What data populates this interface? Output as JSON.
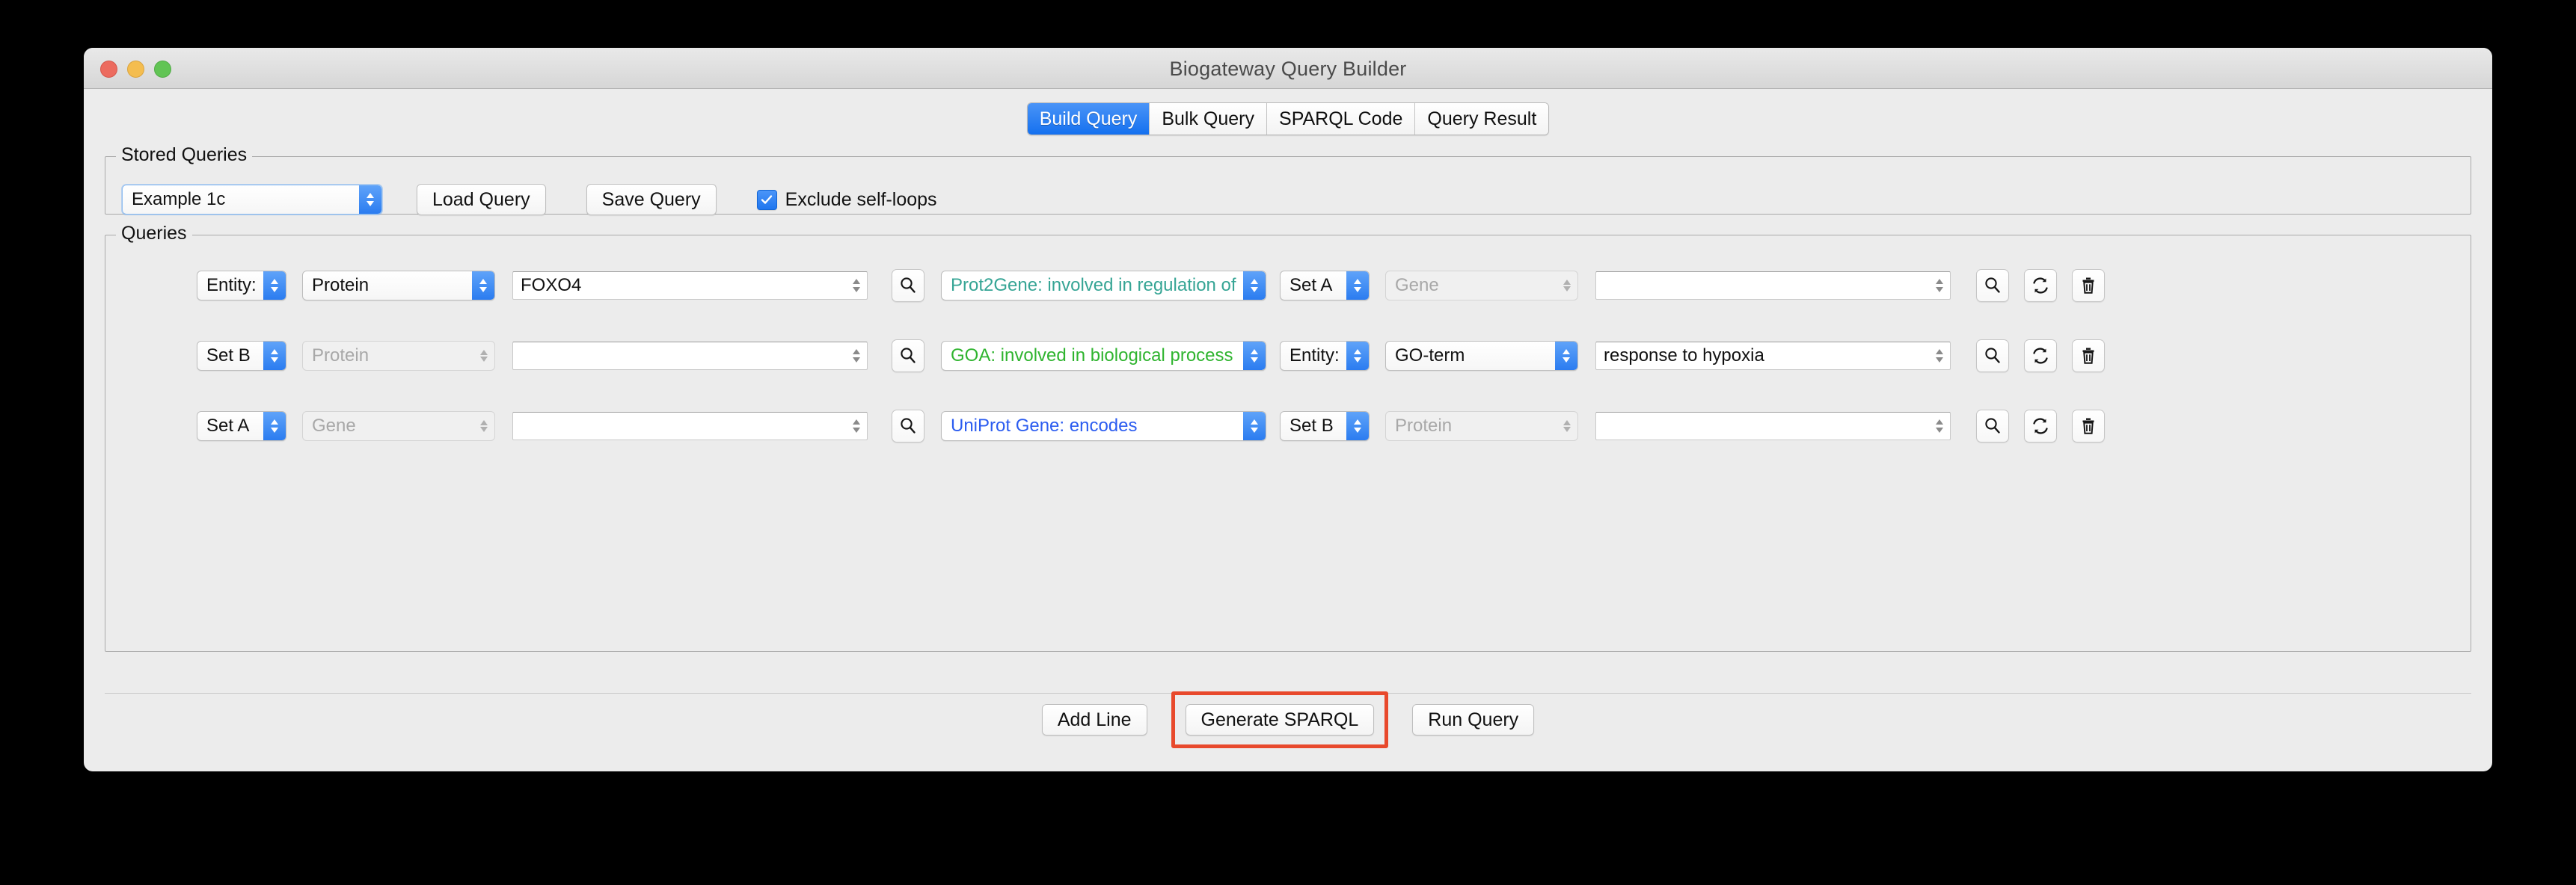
{
  "window": {
    "title": "Biogateway Query Builder",
    "traffic_lights": [
      "close-button",
      "minimize-button",
      "zoom-button"
    ]
  },
  "tabs": [
    {
      "label": "Build Query",
      "active": true
    },
    {
      "label": "Bulk Query",
      "active": false
    },
    {
      "label": "SPARQL Code",
      "active": false
    },
    {
      "label": "Query Result",
      "active": false
    }
  ],
  "stored_queries": {
    "legend": "Stored Queries",
    "selected": "Example 1c",
    "load_label": "Load Query",
    "save_label": "Save Query",
    "exclude_self_loops_label": "Exclude self-loops",
    "exclude_self_loops_checked": true
  },
  "queries": {
    "legend": "Queries",
    "rows": [
      {
        "subject_set": "Entity:",
        "subject_type": "Protein",
        "subject_type_disabled": false,
        "subject_value": "FOXO4",
        "relation": "Prot2Gene: involved in regulation of",
        "relation_color": "#36a595",
        "object_set": "Set A",
        "object_type": "Gene",
        "object_type_disabled": true,
        "object_value": ""
      },
      {
        "subject_set": "Set B",
        "subject_type": "Protein",
        "subject_type_disabled": true,
        "subject_value": "",
        "relation": "GOA: involved in biological process",
        "relation_color": "#2fb42f",
        "object_set": "Entity:",
        "object_type": "GO-term",
        "object_type_disabled": false,
        "object_value": "response to hypoxia"
      },
      {
        "subject_set": "Set A",
        "subject_type": "Gene",
        "subject_type_disabled": true,
        "subject_value": "",
        "relation": "UniProt Gene: encodes",
        "relation_color": "#2b5cf0",
        "object_set": "Set B",
        "object_type": "Protein",
        "object_type_disabled": true,
        "object_value": ""
      }
    ],
    "row_icons": [
      "search-icon",
      "refresh-icon",
      "trash-icon"
    ]
  },
  "footer": {
    "add_line_label": "Add Line",
    "generate_sparql_label": "Generate SPARQL",
    "run_query_label": "Run Query",
    "highlight_color": "#e8492c"
  }
}
